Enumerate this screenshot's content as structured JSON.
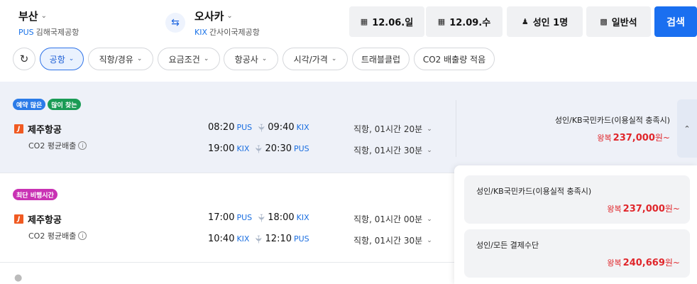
{
  "search": {
    "origin": {
      "city": "부산",
      "code": "PUS",
      "airport": "김해국제공항"
    },
    "destination": {
      "city": "오사카",
      "code": "KIX",
      "airport": "간사이국제공항"
    },
    "depart_date": "12.06.일",
    "return_date": "12.09.수",
    "passengers": "성인 1명",
    "cabin": "일반석",
    "search_label": "검색"
  },
  "filters": [
    {
      "label": "공항",
      "active": true
    },
    {
      "label": "직항/경유"
    },
    {
      "label": "요금조건"
    },
    {
      "label": "항공사"
    },
    {
      "label": "시각/가격"
    },
    {
      "label": "트래블클럽"
    },
    {
      "label": "CO2 배출량 적음"
    }
  ],
  "results": [
    {
      "badges": [
        "예약 많은",
        "많이 찾는"
      ],
      "airline": "제주항공",
      "co2_label": "CO2 평균배출",
      "outbound": {
        "dep_time": "08:20",
        "dep_code": "PUS",
        "arr_time": "09:40",
        "arr_code": "KIX",
        "duration": "직항, 01시간 20분"
      },
      "inbound": {
        "dep_time": "19:00",
        "dep_code": "KIX",
        "arr_time": "20:30",
        "arr_code": "PUS",
        "duration": "직항, 01시간 30분"
      },
      "fare_name": "성인/KB국민카드(이용실적 충족시)",
      "price_prefix": "왕복",
      "price": "237,000",
      "price_suffix": "원~"
    },
    {
      "badges": [
        "최단 비행시간"
      ],
      "airline": "제주항공",
      "co2_label": "CO2 평균배출",
      "outbound": {
        "dep_time": "17:00",
        "dep_code": "PUS",
        "arr_time": "18:00",
        "arr_code": "KIX",
        "duration": "직항, 01시간 00분"
      },
      "inbound": {
        "dep_time": "10:40",
        "dep_code": "KIX",
        "arr_time": "12:10",
        "arr_code": "PUS",
        "duration": "직항, 01시간 30분"
      }
    }
  ],
  "fare_options": [
    {
      "name": "성인/KB국민카드(이용실적 충족시)",
      "price_prefix": "왕복",
      "price": "237,000",
      "price_suffix": "원~"
    },
    {
      "name": "성인/모든 결제수단",
      "price_prefix": "왕복",
      "price": "240,669",
      "price_suffix": "원~"
    }
  ],
  "colors": {
    "accent": "#1a6ff0",
    "price": "#e0262b",
    "airport_code": "#1a6ee0",
    "badge_blue": "#2b7be8",
    "badge_green": "#1a9b55",
    "badge_purple": "#c932b4"
  }
}
